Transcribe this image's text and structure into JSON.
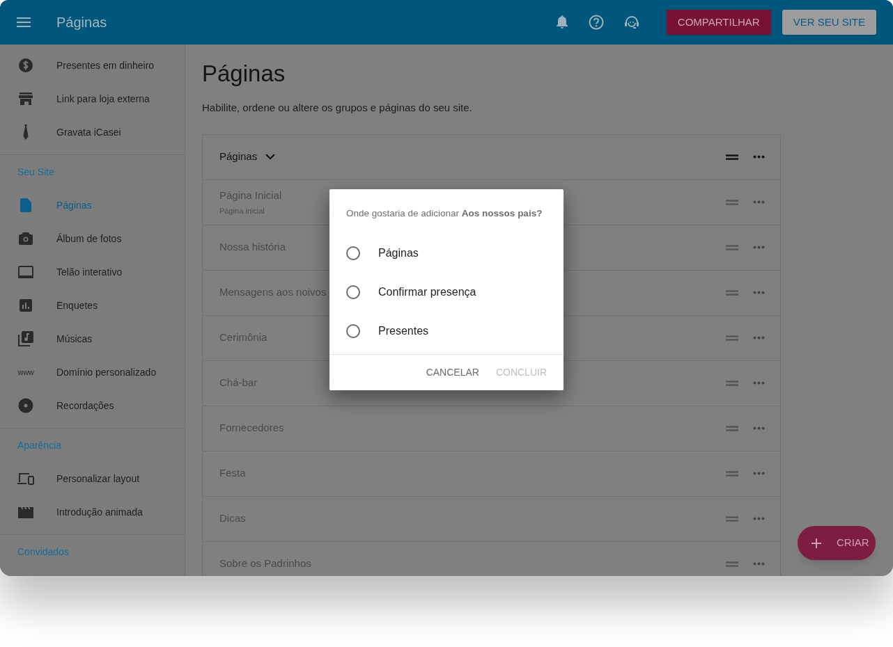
{
  "app_bar": {
    "title": "Páginas",
    "share_button": "COMPARTILHAR",
    "view_site_button": "VER SEU SITE"
  },
  "sidebar": {
    "sections": [
      {
        "items": [
          {
            "label": "Presentes em dinheiro",
            "selected": false
          },
          {
            "label": "Link para loja externa",
            "selected": false
          },
          {
            "label": "Gravata iCasei",
            "selected": false
          }
        ]
      },
      {
        "label": "Seu Site",
        "items": [
          {
            "label": "Páginas",
            "selected": true
          },
          {
            "label": "Álbum de fotos",
            "selected": false
          },
          {
            "label": "Telão interativo",
            "selected": false
          },
          {
            "label": "Enquetes",
            "selected": false
          },
          {
            "label": "Músicas",
            "selected": false
          },
          {
            "label": "Domínio personalizado",
            "selected": false,
            "icon_text": "www"
          },
          {
            "label": "Recordações",
            "selected": false
          }
        ]
      },
      {
        "label": "Aparência",
        "items": [
          {
            "label": "Personalizar layout",
            "selected": false
          },
          {
            "label": "Introdução animada",
            "selected": false
          }
        ]
      },
      {
        "label": "Convidados"
      }
    ]
  },
  "main": {
    "title": "Páginas",
    "description": "Habilite, ordene ou altere os grupos e páginas do seu site.",
    "group": {
      "title": "Páginas",
      "expanded": true,
      "rows": [
        {
          "title": "Página Inicial",
          "subtitle": "Página inicial"
        },
        {
          "title": "Nossa história"
        },
        {
          "title": "Mensagens aos noivos"
        },
        {
          "title": "Cerimônia"
        },
        {
          "title": "Chá-bar"
        },
        {
          "title": "Fornecedores"
        },
        {
          "title": "Festa"
        },
        {
          "title": "Dicas"
        },
        {
          "title": "Sobre os Padrinhos"
        }
      ]
    }
  },
  "fab": {
    "label": "CRIAR"
  },
  "dialog": {
    "prompt": "Onde gostaria de adicionar **Aos nossos pais?**",
    "options": [
      {
        "label": "Páginas",
        "selected": false
      },
      {
        "label": "Confirmar presença",
        "selected": false
      },
      {
        "label": "Presentes",
        "selected": false
      }
    ],
    "buttons": [
      {
        "label": "CANCELAR",
        "disabled": false
      },
      {
        "label": "CONCLUIR",
        "disabled": true
      }
    ]
  }
}
